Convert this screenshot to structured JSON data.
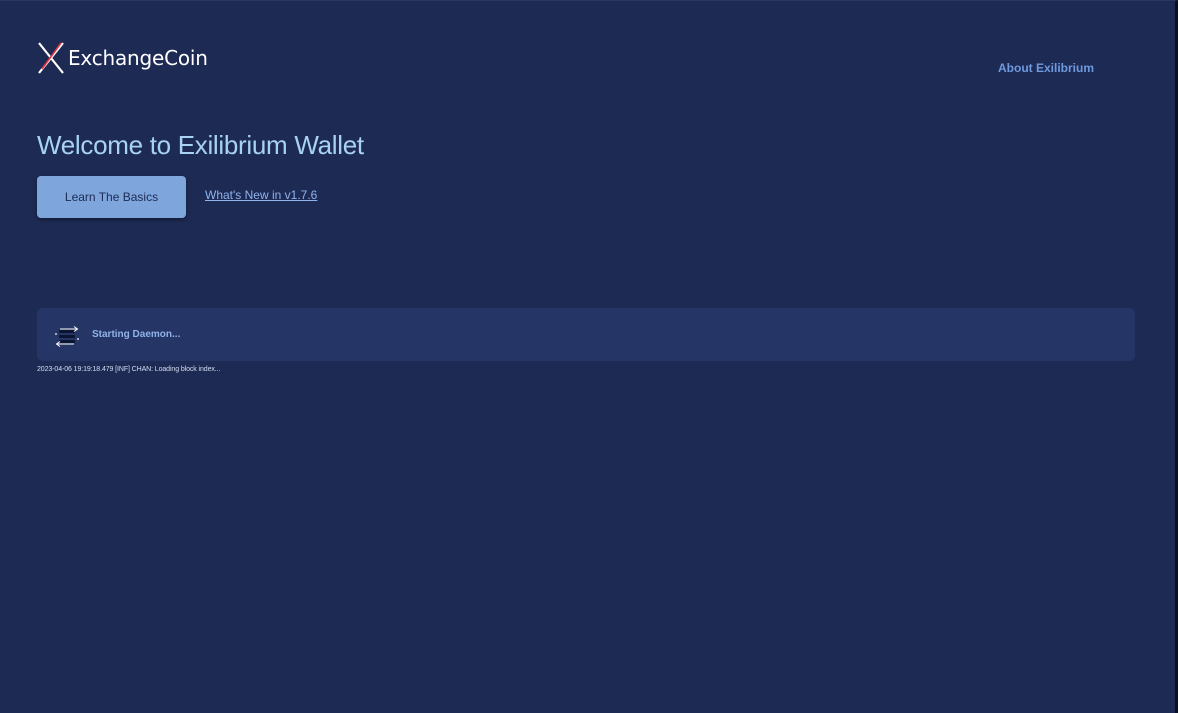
{
  "brand": {
    "name": "ExchangeCoin",
    "logo_icon": "exchangecoin-x-logo",
    "colors": {
      "mark_primary": "#ffffff",
      "mark_accent": "#e5323f"
    }
  },
  "nav": {
    "about_label": "About Exilibrium"
  },
  "hero": {
    "title": "Welcome to Exilibrium Wallet",
    "learn_button_label": "Learn The Basics",
    "whats_new_link": "What's New in v1.7.6"
  },
  "status": {
    "icon": "daemon-sync-icon",
    "message": "Starting Daemon...",
    "log_line": "2023-04-06 19:19:18.479 [INF] CHAN: Loading block index..."
  },
  "theme": {
    "background": "#1d2a54",
    "panel": "#253566",
    "accent": "#7ea6dc",
    "heading": "#a8d2f2",
    "link": "#6f99dd"
  }
}
